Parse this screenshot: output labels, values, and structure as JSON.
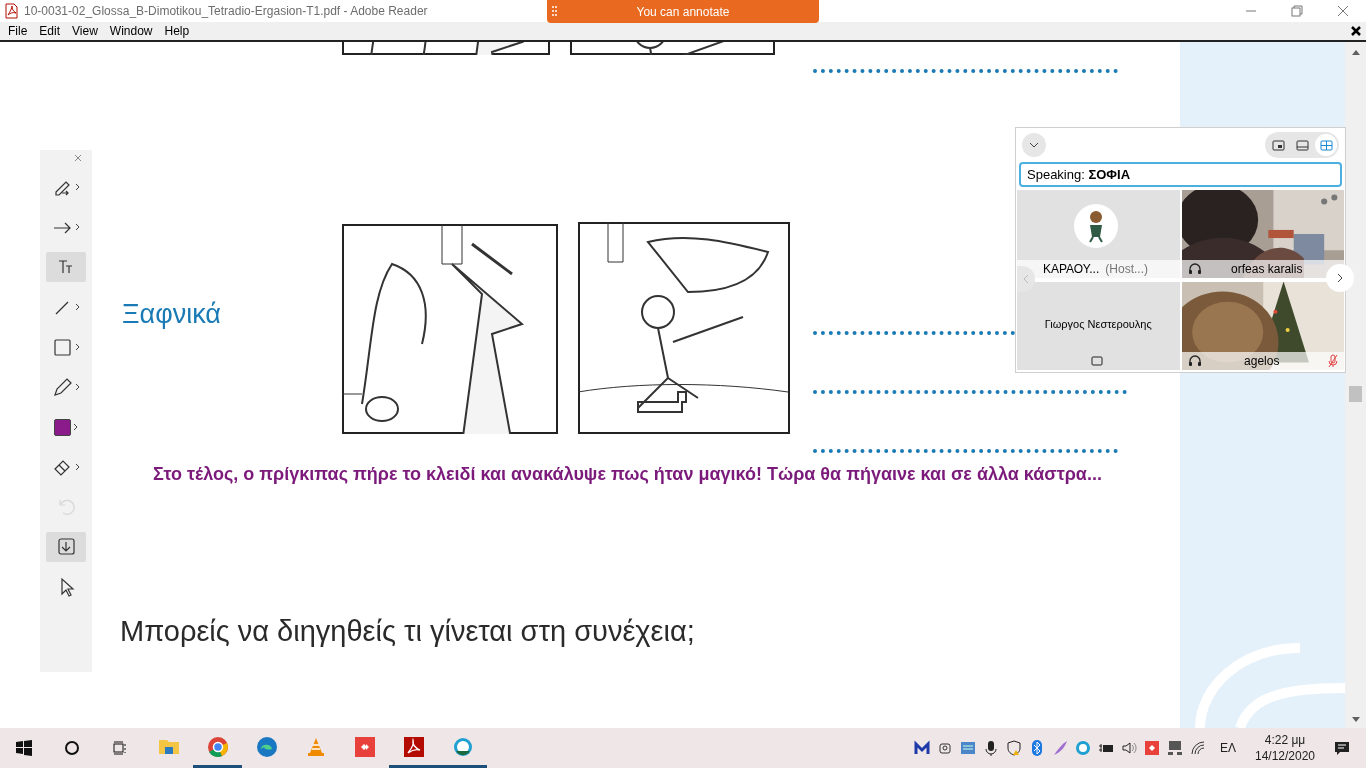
{
  "window": {
    "title": "10-0031-02_Glossa_B-Dimotikou_Tetradio-Ergasion-T1.pdf - Adobe Reader"
  },
  "banner": {
    "label": "You can annotate"
  },
  "menu": [
    "File",
    "Edit",
    "View",
    "Window",
    "Help"
  ],
  "annotation_toolbar": {
    "tools": [
      {
        "kind": "highlighter",
        "selected": false,
        "submenu": true,
        "disabled": false
      },
      {
        "kind": "arrow",
        "selected": false,
        "submenu": true,
        "disabled": false
      },
      {
        "kind": "text",
        "selected": true,
        "submenu": false,
        "disabled": false
      },
      {
        "kind": "line",
        "selected": false,
        "submenu": true,
        "disabled": false
      },
      {
        "kind": "rectangle",
        "selected": false,
        "submenu": true,
        "disabled": false
      },
      {
        "kind": "pencil",
        "selected": false,
        "submenu": true,
        "disabled": false
      },
      {
        "kind": "color",
        "selected": false,
        "submenu": true,
        "disabled": false,
        "color": "#8b1a8b"
      },
      {
        "kind": "eraser",
        "selected": false,
        "submenu": true,
        "disabled": false
      },
      {
        "kind": "undo",
        "selected": false,
        "submenu": false,
        "disabled": true
      },
      {
        "kind": "save",
        "selected": true,
        "submenu": false,
        "disabled": false
      },
      {
        "kind": "pointer",
        "selected": false,
        "submenu": false,
        "disabled": false
      }
    ]
  },
  "document": {
    "heading": "Ξαφνικά",
    "caption": "Στο τέλος, ο πρίγκιπας πήρε το κλειδί και ανακάλυψε πως ήταν μαγικό! Τώρα θα πήγαινε και σε άλλα κάστρα...",
    "question": "Μπορείς να διηγηθείς τι γίνεται στη συνέχεια;"
  },
  "meeting_panel": {
    "views": [
      {
        "kind": "pip",
        "selected": false
      },
      {
        "kind": "filmstrip",
        "selected": false
      },
      {
        "kind": "grid",
        "selected": true
      }
    ],
    "speaking": "Speaking: **ΣΟΦΙΑ**",
    "participants": [
      {
        "kind": "avatar",
        "name": "ΚΑΡΑΟΥ...",
        "role": "(Host...)",
        "muted": false
      },
      {
        "kind": "video",
        "name": "orfeas karalis",
        "muted": false
      },
      {
        "kind": "blank",
        "name": "Γιωργος Νεστερουλης",
        "muted": false
      },
      {
        "kind": "video",
        "name": "agelos",
        "muted": true
      }
    ]
  },
  "taskbar": {
    "apps": [
      {
        "kind": "folder",
        "running": false
      },
      {
        "kind": "browser",
        "running": true
      },
      {
        "kind": "edge",
        "running": false
      },
      {
        "kind": "cone",
        "running": false
      },
      {
        "kind": "remote",
        "running": false
      },
      {
        "kind": "pdf",
        "running": true
      },
      {
        "kind": "ring",
        "running": true
      }
    ],
    "language": "ΕΛ",
    "time": "4:22 μμ",
    "date": "14/12/2020"
  }
}
